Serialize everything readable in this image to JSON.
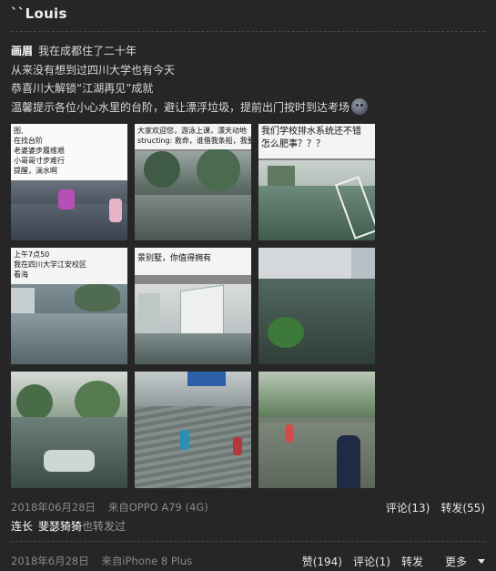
{
  "user": {
    "name": "``Louis"
  },
  "post": {
    "lines": [
      {
        "tag": "画眉",
        "text": "我在成都住了二十年"
      },
      {
        "tag": "",
        "text": "从来没有想到过四川大学也有今天"
      },
      {
        "tag": "",
        "text": "恭喜川大解锁“江湖再见”成就"
      },
      {
        "tag": "",
        "text": "温馨提示各位小心水里的台阶，避让漂浮垃圾，提前出门按时到达考场"
      }
    ],
    "emoji": "sad-face-icon",
    "images": [
      {
        "caption": "图,\n在找台阶\n老婆婆步履维艰\n小哥哥寸步难行\n提醒，淌水啊"
      },
      {
        "caption": "大家欢迎您，游泳上课，漂天动地\nstructing: 救命，谁借我条船，我要考试"
      },
      {
        "caption": "我们学校排水系统还不错\n怎么肥事？？？"
      },
      {
        "caption": "上午7点50\n我在四川大学江安校区\n看海"
      },
      {
        "caption": "景别墅，你值得拥有"
      },
      {
        "caption": ""
      },
      {
        "caption": ""
      },
      {
        "caption": ""
      },
      {
        "caption": ""
      }
    ],
    "date": "2018年06月28日",
    "source": "来自OPPO A79 (4G)",
    "comments_label": "评论(13)",
    "repost_label": "转发(55)"
  },
  "repost_line": {
    "names": [
      "连长",
      "斐瑟猗猗"
    ],
    "suffix": "也转发过"
  },
  "footer": {
    "date": "2018年6月28日",
    "source": "来自iPhone 8 Plus",
    "likes_label": "赞(194)",
    "comments_label": "评论(1)",
    "repost_label": "转发",
    "more_label": "更多"
  }
}
